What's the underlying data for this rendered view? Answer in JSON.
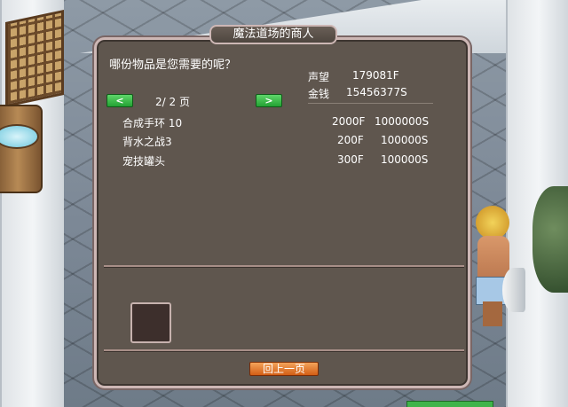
{
  "dialog": {
    "title": "魔法道场的商人",
    "question": "哪份物品是您需要的呢？"
  },
  "stats": {
    "reputation_label": "声望",
    "reputation_value": "179081F",
    "money_label": "金钱",
    "money_value": "15456377S"
  },
  "pager": {
    "prev_label": "<",
    "next_label": ">",
    "page_text": "2/ 2 页"
  },
  "items": [
    {
      "name": "合成手环 10",
      "reputation": "2000F",
      "price": "1000000S"
    },
    {
      "name": "背水之战3",
      "reputation": "200F",
      "price": "100000S"
    },
    {
      "name": "宠技罐头",
      "reputation": "300F",
      "price": "100000S"
    }
  ],
  "footer": {
    "back_label": "回上一页"
  },
  "colors": {
    "dialog_bg": "#5f564e",
    "dialog_border": "#cdb7b5",
    "arrow_button": "#23a233",
    "back_button": "#d35f16"
  },
  "icons": {
    "prev": "chevron-left-icon",
    "next": "chevron-right-icon"
  }
}
